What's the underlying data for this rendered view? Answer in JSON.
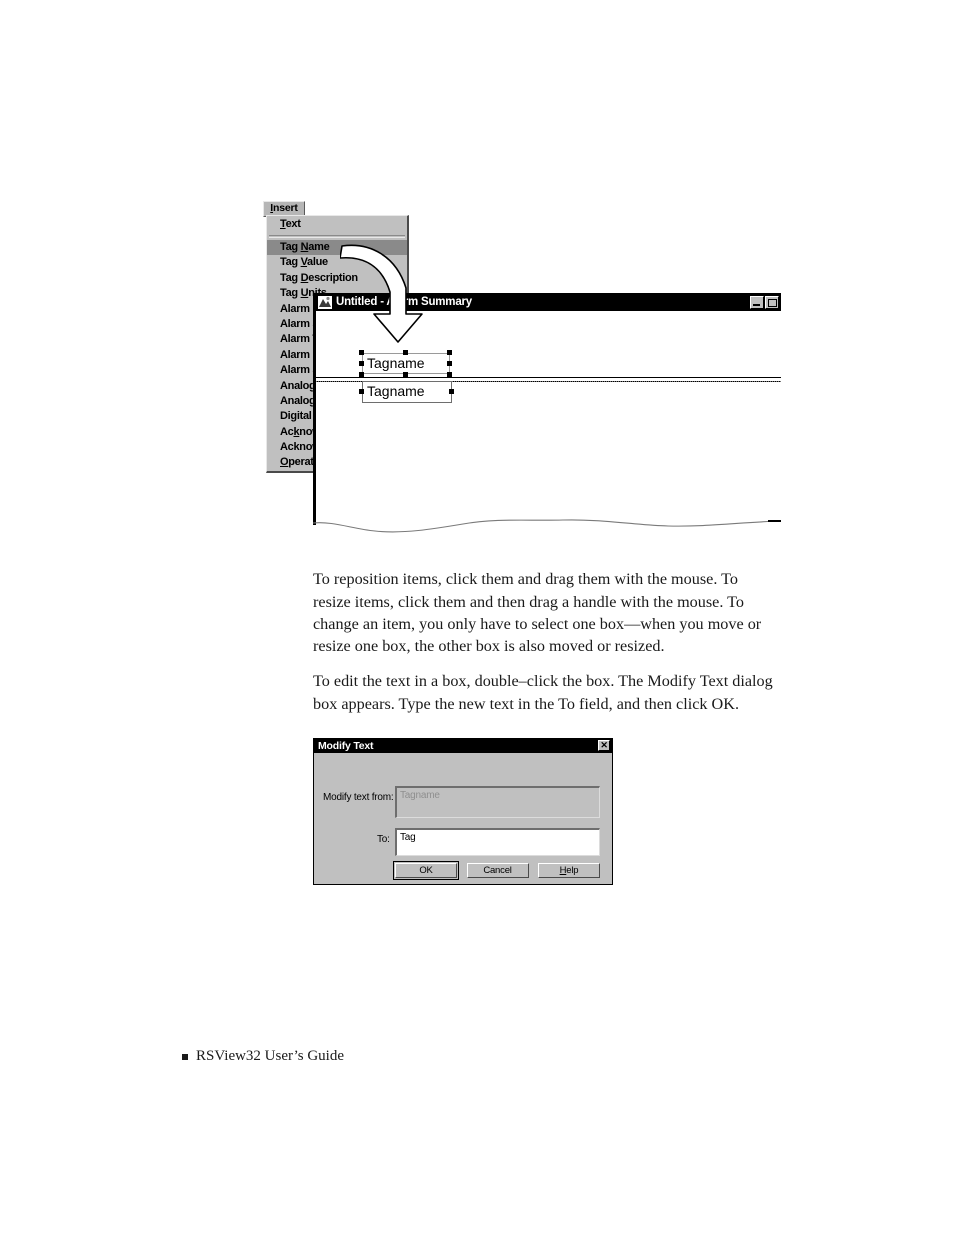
{
  "figure": {
    "menu": {
      "title": "Insert",
      "title_mnemonic": "I",
      "items": [
        {
          "label": "Text",
          "mnemonic": "T",
          "selected": false,
          "separator_after": true
        },
        {
          "label": "Tag Name",
          "mnemonic": "N",
          "selected": true,
          "separator_after": false
        },
        {
          "label": "Tag Value",
          "mnemonic": "V",
          "selected": false,
          "separator_after": false
        },
        {
          "label": "Tag Description",
          "mnemonic": "D",
          "selected": false,
          "separator_after": false
        },
        {
          "label": "Tag Units",
          "mnemonic": "U",
          "selected": false,
          "separator_after": false
        },
        {
          "label": "Alarm Label",
          "mnemonic": "",
          "selected": false,
          "separator_after": false
        },
        {
          "label": "Alarm Severity",
          "mnemonic": "",
          "selected": false,
          "separator_after": false
        },
        {
          "label": "Alarm Time",
          "mnemonic": "",
          "selected": false,
          "separator_after": false
        },
        {
          "label": "Alarm Date",
          "mnemonic": "",
          "selected": false,
          "separator_after": false
        },
        {
          "label": "Alarm State",
          "mnemonic": "",
          "selected": false,
          "separator_after": false
        },
        {
          "label": "Analog Value",
          "mnemonic": "",
          "selected": false,
          "separator_after": false
        },
        {
          "label": "Analog Limit",
          "mnemonic": "",
          "selected": false,
          "separator_after": false
        },
        {
          "label": "Digital Value",
          "mnemonic": "",
          "selected": false,
          "separator_after": false
        },
        {
          "label": "Acknowledge Time",
          "mnemonic": "k",
          "selected": false,
          "separator_after": false
        },
        {
          "label": "Acknowledge Date",
          "mnemonic": "",
          "selected": false,
          "separator_after": false
        },
        {
          "label": "Operator Name",
          "mnemonic": "O",
          "selected": false,
          "separator_after": false
        }
      ]
    },
    "alarm_window": {
      "title": "Untitled - Alarm Summary",
      "icon": "alarm-summary-icon",
      "minimize_label": "Minimize",
      "maximize_label": "Maximize",
      "selected_object_text": "Tagname",
      "paired_object_text": "Tagname"
    },
    "arrow": {
      "name": "callout-arrow",
      "from": "Tag Name menu item",
      "to": "Tagname box in alarm summary"
    }
  },
  "content": {
    "paragraph_1": "To reposition items, click them and drag them with the mouse. To resize items, click them and then drag a handle with the mouse. To change an item, you only have to select one box—when you move or resize one box, the other box is also moved or resized.",
    "paragraph_2": "To edit the text in a box, double–click the box. The Modify Text dialog box appears. Type the new text in the To field, and then click OK."
  },
  "dialog": {
    "title": "Modify Text",
    "close_glyph": "✕",
    "from_label": "Modify text from:",
    "from_value": "Tagname",
    "to_label": "To:",
    "to_value": "Tag",
    "buttons": {
      "ok": "OK",
      "cancel": "Cancel",
      "help": "Help",
      "help_mnemonic": "H"
    }
  },
  "footer": {
    "text": "RSView32  User’s Guide"
  },
  "colors": {
    "window_face": "#c0c0c0",
    "titlebar": "#000000",
    "menu_highlight": "#8a8a8a",
    "field_disabled_text": "#8f8f8f"
  }
}
